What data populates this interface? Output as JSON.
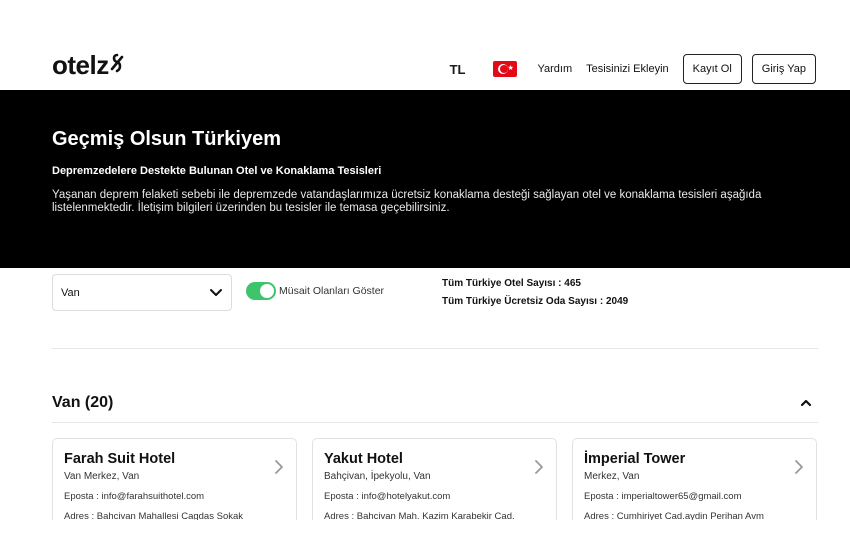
{
  "header": {
    "logo_text": "otelz",
    "currency": "TL",
    "flag": "turkey-flag-icon",
    "help_label": "Yardım",
    "add_property_label": "Tesisinizi Ekleyin",
    "register_label": "Kayıt Ol",
    "login_label": "Giriş Yap"
  },
  "banner": {
    "title": "Geçmiş Olsun Türkiyem",
    "subtitle": "Depremzedelere Destekte Bulunan Otel ve Konaklama Tesisleri",
    "description": "Yaşanan deprem felaketi sebebi ile depremzede vatandaşlarımıza ücretsiz konaklama desteği sağlayan otel ve konaklama tesisleri aşağıda listelenmektedir. İletişim bilgileri üzerinden bu tesisler ile temasa geçebilirsiniz."
  },
  "filters": {
    "city_selected": "Van",
    "available_toggle_label": "Müsait Olanları Göster",
    "available_toggle_on": true,
    "hotel_count_text": "Tüm Türkiye Otel Sayısı : 465",
    "room_count_text": "Tüm Türkiye Ücretsiz Oda Sayısı : 2049"
  },
  "city_section": {
    "heading": "Van (20)"
  },
  "hotels": [
    {
      "name": "Farah Suit Hotel",
      "location": "Van Merkez, Van",
      "email": "Eposta : info@farahsuithotel.com",
      "address": "Adres : Bahcivan Mahallesi Cagdas Sokak"
    },
    {
      "name": "Yakut Hotel",
      "location": "Bahçivan, İpekyolu, Van",
      "email": "Eposta : info@hotelyakut.com",
      "address": "Adres : Bahcivan Mah. Kazim Karabekir Cad."
    },
    {
      "name": "İmperial Tower",
      "location": "Merkez, Van",
      "email": "Eposta : imperialtower65@gmail.com",
      "address": "Adres : Cumhiriyet Cad.aydin Perihan Avm"
    }
  ],
  "colors": {
    "banner_bg": "#000000",
    "toggle_on": "#3ec46d",
    "flag_red": "#e30a17"
  }
}
